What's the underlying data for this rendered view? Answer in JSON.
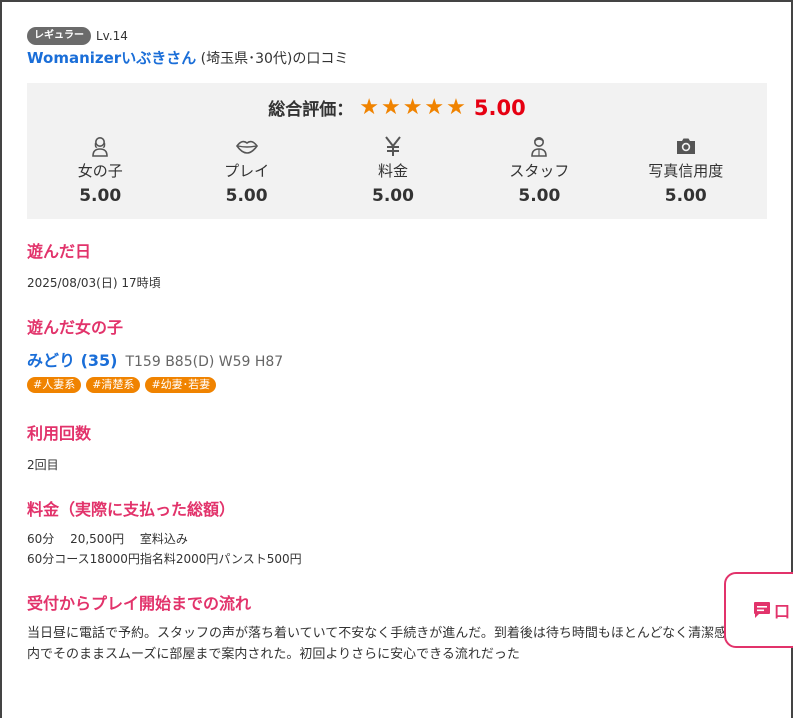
{
  "reviewer": {
    "rank": "レギュラー",
    "level": "Lv.14",
    "name": "Womanizerいぶきさん",
    "meta": "(埼玉県･30代)の口コミ"
  },
  "rating": {
    "overall_label": "総合評価：",
    "stars": "★★★★★",
    "overall_score": "5.00",
    "categories": [
      {
        "icon": "woman-icon",
        "label": "女の子",
        "value": "5.00"
      },
      {
        "icon": "lips-icon",
        "label": "プレイ",
        "value": "5.00"
      },
      {
        "icon": "yen-icon",
        "label": "料金",
        "value": "5.00"
      },
      {
        "icon": "staff-icon",
        "label": "スタッフ",
        "value": "5.00"
      },
      {
        "icon": "camera-icon",
        "label": "写真信用度",
        "value": "5.00"
      }
    ],
    "star_color": "#f08300",
    "score_color": "#e60012"
  },
  "visit_date": {
    "heading": "遊んだ日",
    "value": "2025/08/03(日) 17時頃"
  },
  "girl": {
    "heading": "遊んだ女の子",
    "name": "みどり (35)",
    "spec": "T159 B85(D) W59 H87",
    "tags": [
      "#人妻系",
      "#清楚系",
      "#幼妻･若妻"
    ]
  },
  "usage": {
    "heading": "利用回数",
    "value": "2回目"
  },
  "price": {
    "heading": "料金（実際に支払った総額）",
    "line1": "60分　 20,500円　 室料込み",
    "line2": "60分コース18000円指名料2000円パンスト500円"
  },
  "flow": {
    "heading": "受付からプレイ開始までの流れ",
    "text": "当日昼に電話で予約。スタッフの声が落ち着いていて不安なく手続きが進んだ。到着後は待ち時間もほとんどなく清潔感ある店内でそのままスムーズに部屋まで案内された。初回よりさらに安心できる流れだった"
  },
  "chat": {
    "label": "口",
    "accent": "#e2336b"
  },
  "colors": {
    "link": "#1a6ed8",
    "heading": "#e2336b",
    "tag": "#f08300"
  }
}
